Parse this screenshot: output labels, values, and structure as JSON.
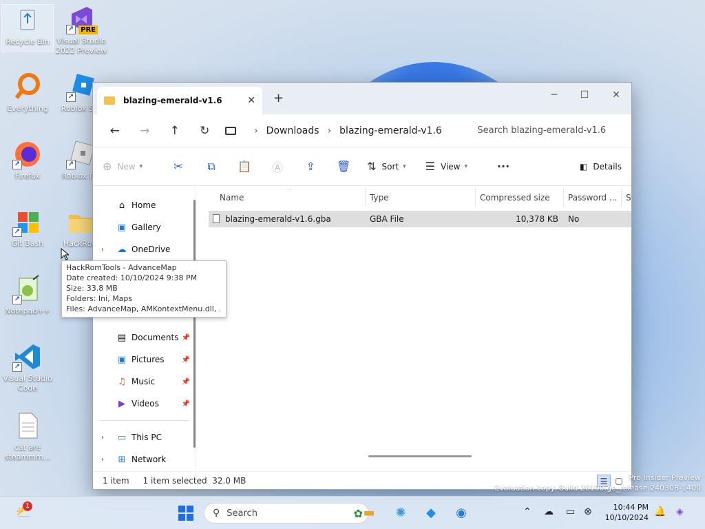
{
  "desktop": {
    "icons": [
      {
        "label": "Recycle Bin"
      },
      {
        "label": "Visual Studio 2022 Preview",
        "badge": "PRE"
      },
      {
        "label": "Everything"
      },
      {
        "label": "Roblox Stu"
      },
      {
        "label": "Firefox"
      },
      {
        "label": "Roblox Pla"
      },
      {
        "label": "Git Bash"
      },
      {
        "label": "HackRom"
      },
      {
        "label": "Notepad++"
      },
      {
        "label": "Visual Studio Code"
      },
      {
        "label": "cat are steammm..."
      }
    ]
  },
  "window": {
    "tab_title": "blazing-emerald-v1.6",
    "breadcrumb": [
      "Downloads",
      "blazing-emerald-v1.6"
    ],
    "search_placeholder": "Search blazing-emerald-v1.6",
    "toolbar": {
      "new": "New",
      "sort": "Sort",
      "view": "View",
      "details": "Details"
    },
    "nav": {
      "home": "Home",
      "gallery": "Gallery",
      "onedrive": "OneDrive",
      "documents": "Documents",
      "pictures": "Pictures",
      "music": "Music",
      "videos": "Videos",
      "thispc": "This PC",
      "network": "Network"
    },
    "columns": [
      "Name",
      "Type",
      "Compressed size",
      "Password ...",
      "Si"
    ],
    "files": [
      {
        "name": "blazing-emerald-v1.6.gba",
        "type": "GBA File",
        "compressed_size": "10,378 KB",
        "password": "No"
      }
    ],
    "status": {
      "count": "1 item",
      "selected": "1 item selected  32.0 MB"
    }
  },
  "tooltip": {
    "lines": [
      "HackRomTools - AdvanceMap",
      "Date created: 10/10/2024 9:38 PM",
      "Size: 33.8 MB",
      "Folders: Ini, Maps",
      "Files: AdvanceMap, AMKontextMenu.dll, ..."
    ]
  },
  "watermark": {
    "line1": "Pro Insider Preview",
    "line2": "Evaluation copy. Build 26100.ge_release.240308-1400"
  },
  "taskbar": {
    "search_placeholder": "Search",
    "time": "10:44 PM",
    "date": "10/10/2024",
    "weather_badge": "1"
  },
  "colors": {
    "accent": "#2a5bd7",
    "selection": "#dedede"
  }
}
